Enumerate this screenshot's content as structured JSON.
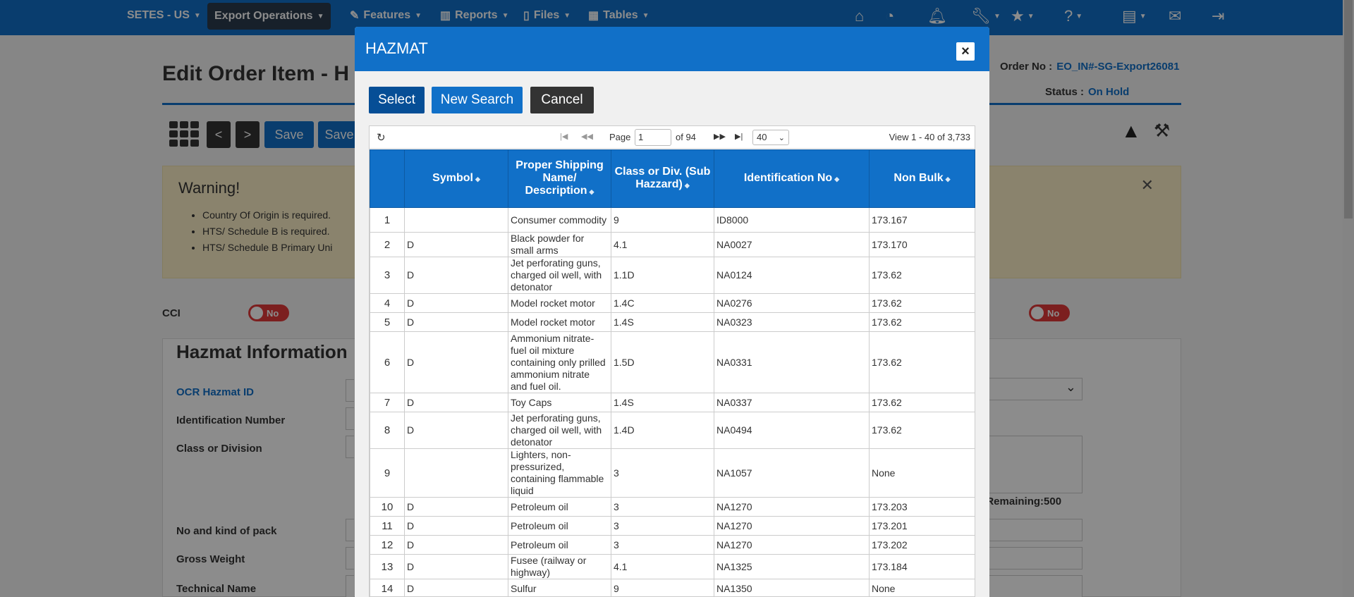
{
  "nav": {
    "org": "SETES - US",
    "module": "Export Operations",
    "features": "Features",
    "reports": "Reports",
    "files": "Files",
    "tables": "Tables"
  },
  "page": {
    "title": "Edit  Order Item - H",
    "order_no_label": "Order No :",
    "order_no_value": "EO_IN#-SG-Export26081",
    "status_label": "Status :",
    "status_value": "On Hold",
    "save_label": "Save",
    "save2_label": "Save",
    "prev_label": "<",
    "next_label": ">"
  },
  "warning": {
    "title": "Warning!",
    "items": [
      "Country Of Origin is required.",
      "HTS/ Schedule B is required.",
      "HTS/ Schedule B Primary Uni"
    ]
  },
  "cci": {
    "label": "CCI",
    "toggle": "No",
    "toggle2": "No"
  },
  "hazmat_form": {
    "heading": "Hazmat Information",
    "ocr_label": "OCR Hazmat ID",
    "id_number_label": "Identification Number",
    "class_label": "Class or Division",
    "chars_remaining": "rs Remaining:500",
    "pack_label": "No and kind of pack",
    "gross_weight_label": "Gross Weight",
    "technical_name_label": "Technical Name"
  },
  "modal": {
    "title": "HAZMAT",
    "close": "×",
    "select_label": "Select",
    "new_search_label": "New Search",
    "cancel_label": "Cancel",
    "pager": {
      "page_label": "Page",
      "page_value": "1",
      "of_label": "of 94",
      "rows_per_page": "40",
      "view_label": "View 1 - 40 of 3,733"
    },
    "columns": [
      "",
      "Symbol",
      "Proper Shipping Name/ Description",
      "Class or Div. (Sub Hazzard)",
      "Identification No",
      "Non Bulk"
    ],
    "rows": [
      {
        "n": "1",
        "symbol": "",
        "name": "Consumer commodity",
        "class": "9",
        "id": "ID8000",
        "nonbulk": "173.167"
      },
      {
        "n": "2",
        "symbol": "D",
        "name": "Black powder for small arms",
        "class": "4.1",
        "id": "NA0027",
        "nonbulk": "173.170"
      },
      {
        "n": "3",
        "symbol": "D",
        "name": "Jet perforating guns, charged oil well, with detonator",
        "class": "1.1D",
        "id": "NA0124",
        "nonbulk": "173.62"
      },
      {
        "n": "4",
        "symbol": "D",
        "name": "Model rocket motor",
        "class": "1.4C",
        "id": "NA0276",
        "nonbulk": "173.62"
      },
      {
        "n": "5",
        "symbol": "D",
        "name": "Model rocket motor",
        "class": "1.4S",
        "id": "NA0323",
        "nonbulk": "173.62"
      },
      {
        "n": "6",
        "symbol": "D",
        "name": "Ammonium nitrate-fuel oil mixture containing only prilled ammonium nitrate and fuel oil.",
        "class": "1.5D",
        "id": "NA0331",
        "nonbulk": "173.62"
      },
      {
        "n": "7",
        "symbol": "D",
        "name": "Toy Caps",
        "class": "1.4S",
        "id": "NA0337",
        "nonbulk": "173.62"
      },
      {
        "n": "8",
        "symbol": "D",
        "name": "Jet perforating guns, charged oil well, with detonator",
        "class": "1.4D",
        "id": "NA0494",
        "nonbulk": "173.62"
      },
      {
        "n": "9",
        "symbol": "",
        "name": "Lighters, non-pressurized, containing flammable liquid",
        "class": "3",
        "id": "NA1057",
        "nonbulk": "None"
      },
      {
        "n": "10",
        "symbol": "D",
        "name": "Petroleum oil",
        "class": "3",
        "id": "NA1270",
        "nonbulk": "173.203"
      },
      {
        "n": "11",
        "symbol": "D",
        "name": "Petroleum oil",
        "class": "3",
        "id": "NA1270",
        "nonbulk": "173.201"
      },
      {
        "n": "12",
        "symbol": "D",
        "name": "Petroleum oil",
        "class": "3",
        "id": "NA1270",
        "nonbulk": "173.202"
      },
      {
        "n": "13",
        "symbol": "D",
        "name": "Fusee (railway or highway)",
        "class": "4.1",
        "id": "NA1325",
        "nonbulk": "173.184"
      },
      {
        "n": "14",
        "symbol": "D",
        "name": "Sulfur",
        "class": "9",
        "id": "NA1350",
        "nonbulk": "None"
      }
    ]
  },
  "colors": {
    "primary": "#1170c8",
    "dark": "#333333",
    "warning_bg": "#fbefc7",
    "toggle_red": "#e23a3a"
  }
}
